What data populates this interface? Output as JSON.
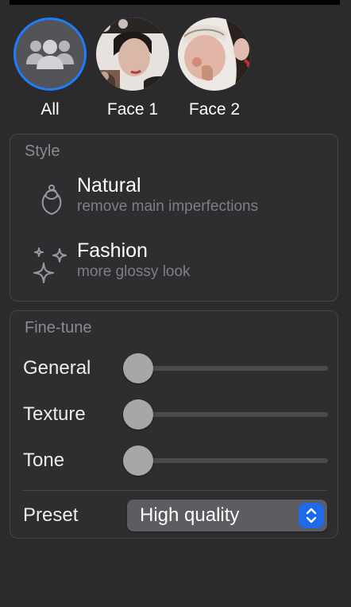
{
  "faces": [
    {
      "id": "all",
      "label": "All",
      "selected": true,
      "icon": "group-icon"
    },
    {
      "id": "face1",
      "label": "Face 1",
      "selected": false,
      "icon": "face-photo"
    },
    {
      "id": "face2",
      "label": "Face 2",
      "selected": false,
      "icon": "face-photo"
    }
  ],
  "style": {
    "title": "Style",
    "options": [
      {
        "name": "Natural",
        "description": "remove main imperfections",
        "icon": "face-outline-icon"
      },
      {
        "name": "Fashion",
        "description": "more glossy look",
        "icon": "sparkles-icon"
      }
    ]
  },
  "finetune": {
    "title": "Fine-tune",
    "sliders": [
      {
        "label": "General",
        "value": 0
      },
      {
        "label": "Texture",
        "value": 0
      },
      {
        "label": "Tone",
        "value": 0
      }
    ],
    "preset": {
      "label": "Preset",
      "value": "High quality"
    }
  },
  "colors": {
    "background": "#2b2b2d",
    "accent": "#1f7cff",
    "select_stepper": "#1f6ae8"
  }
}
